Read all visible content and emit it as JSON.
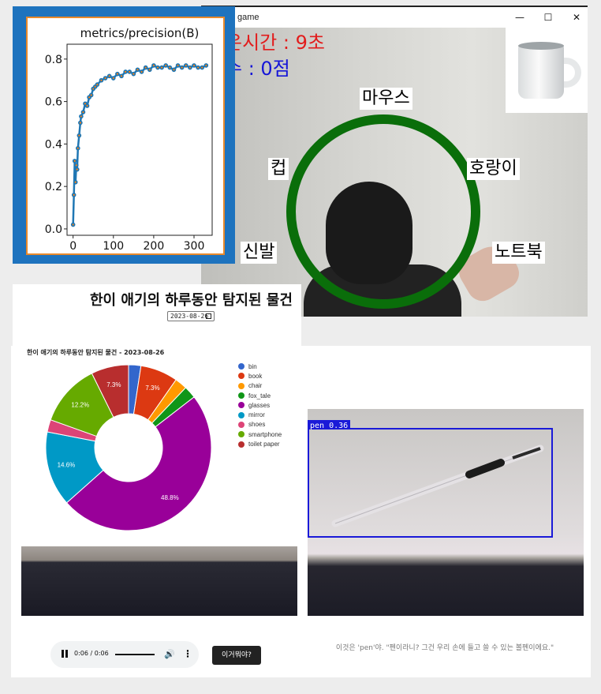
{
  "game_window": {
    "title": "game",
    "minimize": "—",
    "maximize": "☐",
    "close": "✕",
    "timer_text": "은시간 : 9초",
    "score_text": "수 : 0점",
    "words": {
      "top": "마우스",
      "left": "컵",
      "right": "호랑이",
      "bottom_left": "신발",
      "bottom_right": "노트북"
    },
    "ring_color": "#0a6e0a"
  },
  "training_chart": {
    "chart_data": {
      "type": "line",
      "title": "metrics/precision(B)",
      "xlim": [
        -15,
        345
      ],
      "ylim": [
        -0.03,
        0.87
      ],
      "xticks": [
        0,
        100,
        200,
        300
      ],
      "yticks": [
        0.0,
        0.2,
        0.4,
        0.6,
        0.8
      ],
      "x": [
        0,
        2,
        4,
        6,
        8,
        10,
        12,
        15,
        18,
        20,
        25,
        30,
        35,
        40,
        45,
        50,
        55,
        60,
        70,
        80,
        90,
        100,
        110,
        120,
        130,
        140,
        150,
        160,
        170,
        180,
        190,
        200,
        210,
        220,
        230,
        240,
        250,
        260,
        270,
        280,
        290,
        300,
        310,
        320,
        330
      ],
      "y": [
        0.02,
        0.16,
        0.32,
        0.22,
        0.3,
        0.28,
        0.38,
        0.44,
        0.5,
        0.53,
        0.55,
        0.59,
        0.58,
        0.62,
        0.63,
        0.66,
        0.67,
        0.68,
        0.7,
        0.71,
        0.72,
        0.71,
        0.73,
        0.72,
        0.74,
        0.74,
        0.73,
        0.75,
        0.74,
        0.76,
        0.75,
        0.77,
        0.76,
        0.76,
        0.77,
        0.76,
        0.75,
        0.77,
        0.76,
        0.77,
        0.76,
        0.77,
        0.76,
        0.76,
        0.77
      ],
      "line_color": "#1f77b4",
      "marker_color": "#ff7f0e"
    }
  },
  "web_page": {
    "heading": "한이 애기의 하루동안 탐지된 물건",
    "date_value": "2023-08-26",
    "pie_title": "한이 애기의 하루동안 탐지된 물건 - 2023-08-26",
    "chart_data": {
      "type": "pie",
      "donut": true,
      "labels": [
        "bin",
        "book",
        "chair",
        "fox_tale",
        "glasses",
        "mirror",
        "shoes",
        "smartphone",
        "toilet paper"
      ],
      "values": [
        2.4,
        7.3,
        2.4,
        2.4,
        48.8,
        14.6,
        2.4,
        12.2,
        7.3
      ],
      "colors": [
        "#3366cc",
        "#dc3912",
        "#ff9900",
        "#109618",
        "#990099",
        "#0099c6",
        "#dd4477",
        "#66aa00",
        "#b82e2e"
      ],
      "data_labels": [
        "7.3%",
        "48.8%",
        "14.6%",
        "12.2%",
        "7.3%"
      ],
      "legend_position": "right"
    },
    "detection_label": "pen  0.36",
    "audio": {
      "time": "0:06 / 0:06",
      "pause_icon": "pause-icon",
      "volume_icon": "volume-icon",
      "more_icon": "more-vertical-icon"
    },
    "what_button": "이거뭐야?",
    "answer_text": "이것은 'pen'야. \"펜이라니? 그건 우리 손에 들고 쓸 수 있는 볼펜이에요.\""
  }
}
